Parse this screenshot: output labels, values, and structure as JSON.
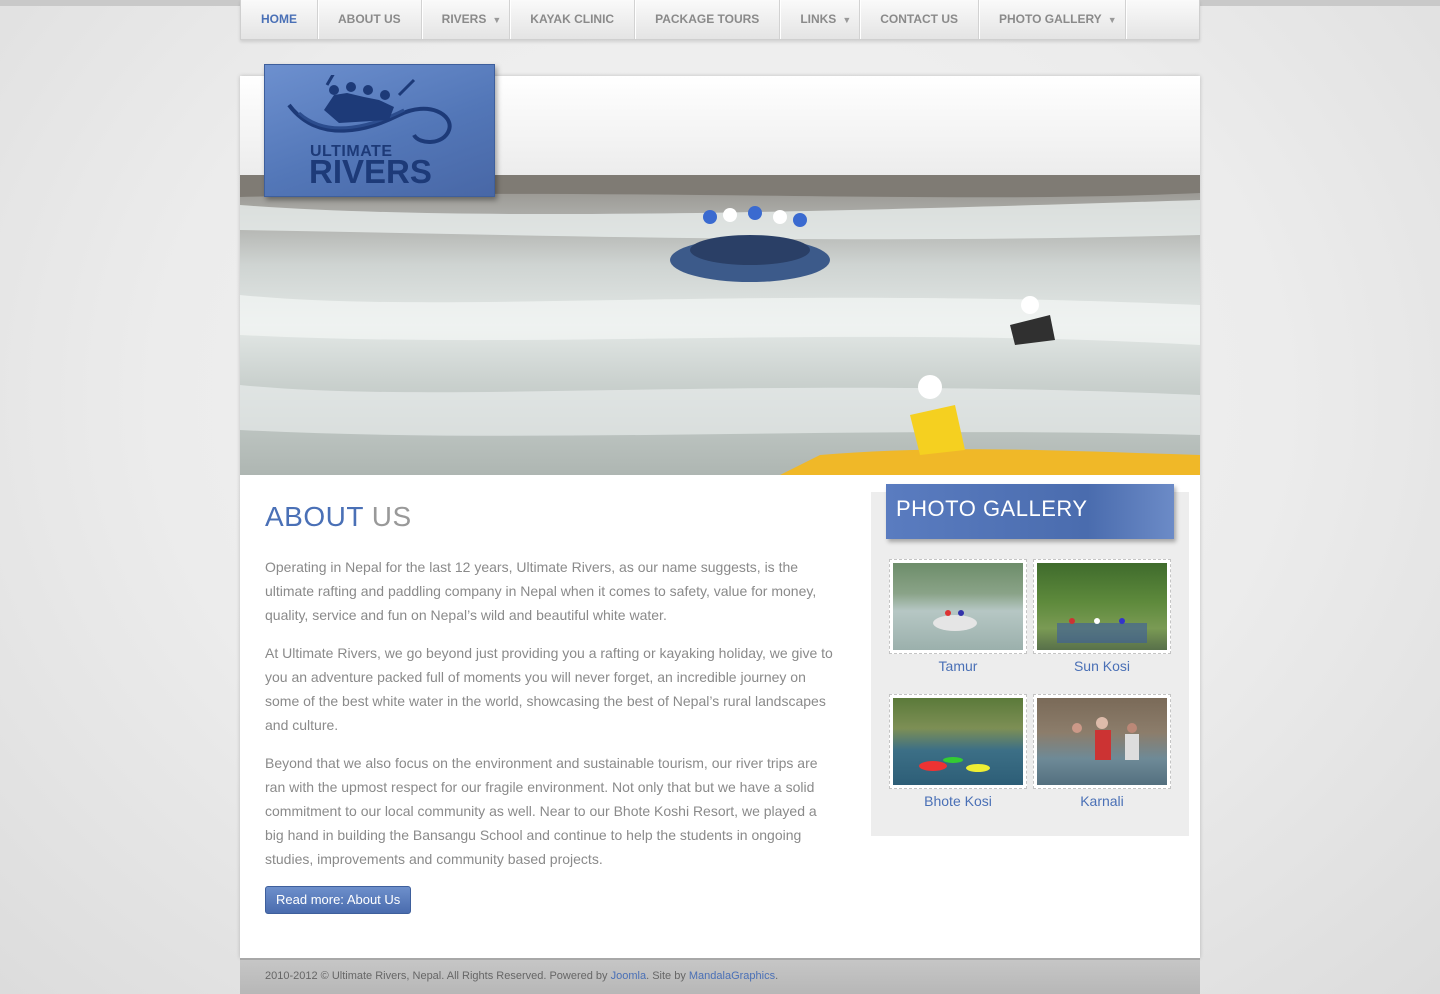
{
  "nav": {
    "items": [
      {
        "label": "HOME",
        "active": true,
        "dropdown": false
      },
      {
        "label": "ABOUT US",
        "active": false,
        "dropdown": false
      },
      {
        "label": "RIVERS",
        "active": false,
        "dropdown": true
      },
      {
        "label": "KAYAK CLINIC",
        "active": false,
        "dropdown": false
      },
      {
        "label": "PACKAGE TOURS",
        "active": false,
        "dropdown": false
      },
      {
        "label": "LINKS",
        "active": false,
        "dropdown": true
      },
      {
        "label": "CONTACT US",
        "active": false,
        "dropdown": false
      },
      {
        "label": "PHOTO GALLERY",
        "active": false,
        "dropdown": true
      }
    ],
    "dropdown_glyph": "▼"
  },
  "logo": {
    "line1": "ULTIMATE",
    "line2": "RIVERS"
  },
  "main": {
    "title_highlight": "ABOUT",
    "title_rest": " US",
    "paragraphs": [
      "Operating in Nepal for the last 12 years, Ultimate Rivers, as our name suggests, is the ultimate rafting and paddling company in Nepal when it comes to safety, value for money, quality, service and fun on Nepal’s wild and beautiful white water.",
      "At Ultimate Rivers, we go beyond just providing you a rafting or kayaking holiday, we give to you an adventure packed full of moments you will never forget, an incredible journey on some of the best white water in the world, showcasing the best of Nepal’s rural landscapes and culture.",
      "Beyond that we also focus on the environment and sustainable tourism, our river trips are ran with the upmost respect for our fragile environment. Not only that but we have a solid commitment to our local community as well. Near to our Bhote Koshi Resort, we played a big hand in building the Bansangu School and continue to help the students in ongoing studies, improvements and community based projects."
    ],
    "read_more": "Read more: About Us"
  },
  "sidebar": {
    "title": "PHOTO GALLERY",
    "photos": [
      {
        "label": "Tamur"
      },
      {
        "label": "Sun Kosi"
      },
      {
        "label": "Bhote Kosi"
      },
      {
        "label": "Karnali"
      }
    ]
  },
  "footer": {
    "text_before": "2010-2012 © Ultimate Rivers, Nepal. All Rights Reserved. Powered by ",
    "joomla": "Joomla",
    "text_mid": ". Site by ",
    "mandala": "MandalaGraphics",
    "text_end": "."
  },
  "colors": {
    "accent": "#4a70b6",
    "text": "#8a8a8a"
  }
}
